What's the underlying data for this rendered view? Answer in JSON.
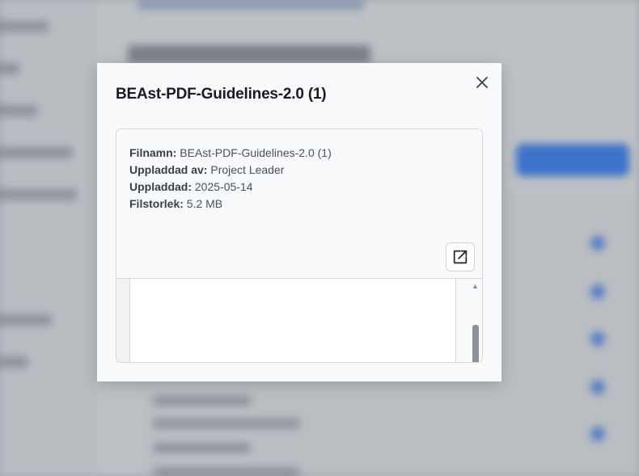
{
  "modal": {
    "title": "BEAst-PDF-Guidelines-2.0 (1)",
    "close_icon": "close-icon",
    "file_info": {
      "filename_label": "Filnamn:",
      "filename_value": "BEAst-PDF-Guidelines-2.0 (1)",
      "uploaded_by_label": "Uppladdad av:",
      "uploaded_by_value": "Project Leader",
      "uploaded_label": "Uppladdad:",
      "uploaded_value": "2025-05-14",
      "filesize_label": "Filstorlek:",
      "filesize_value": "5.2 MB"
    },
    "open_external_icon": "open-in-new-icon",
    "viewer_scroll_up_icon": "triangle-up-icon"
  },
  "colors": {
    "accent": "#3b82f6",
    "modal_bg": "#f8f9fb",
    "overlay": "#464a52"
  }
}
